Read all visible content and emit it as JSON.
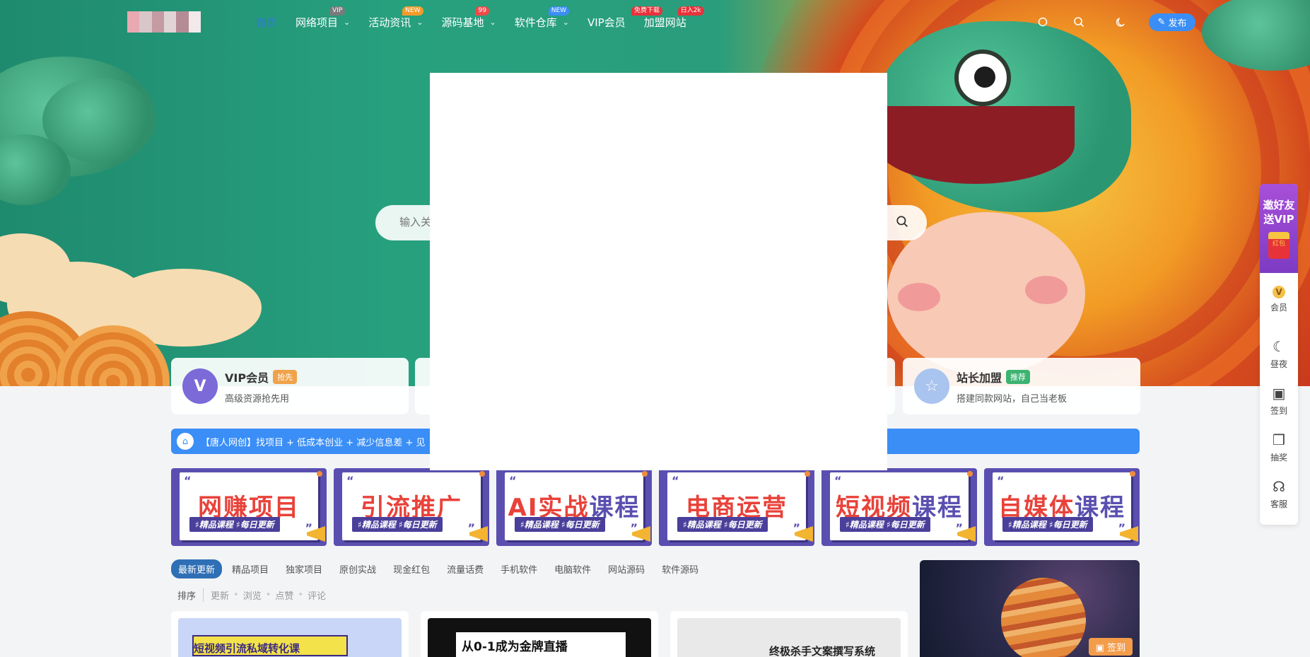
{
  "nav": {
    "items": [
      {
        "label": "首页",
        "badge": "",
        "badge_color": "",
        "chevron": false,
        "active": true
      },
      {
        "label": "网络项目",
        "badge": "VIP",
        "badge_color": "#7a7a7a",
        "chevron": true,
        "active": false
      },
      {
        "label": "活动资讯",
        "badge": "NEW",
        "badge_color": "#f59a2a",
        "chevron": true,
        "active": false
      },
      {
        "label": "源码基地",
        "badge": "99",
        "badge_color": "#ef4a4a",
        "chevron": true,
        "active": false
      },
      {
        "label": "软件仓库",
        "badge": "NEW",
        "badge_color": "#3a8ef6",
        "chevron": true,
        "active": false
      },
      {
        "label": "VIP会员",
        "badge": "免费下载",
        "badge_color": "#e8323a",
        "chevron": false,
        "active": false
      },
      {
        "label": "加盟网站",
        "badge": "日入2k",
        "badge_color": "#e8323a",
        "chevron": false,
        "active": false
      }
    ],
    "publish_label": "发布"
  },
  "search": {
    "placeholder": "输入关"
  },
  "features": [
    {
      "title": "VIP会员",
      "tag": "抢先",
      "tag_color": "#f0a24a",
      "subtitle": "高级资源抢先用",
      "icon": "vip-icon",
      "icon_text": "V",
      "icon_color": "#7b6ad8"
    },
    {
      "title": "站长加盟",
      "tag": "推荐",
      "tag_color": "#3cb371",
      "subtitle": "搭建同款网站，自己当老板",
      "icon": "gear-badge-icon",
      "icon_text": "☆",
      "icon_color": "#8fb2e8"
    }
  ],
  "notice": {
    "text": "【唐人网创】找项目 + 低成本创业 + 减少信息差 + 见"
  },
  "courses": [
    {
      "title": "网赚项目",
      "color": "#e8423a",
      "tags": "♯精品课程 ♯每日更新"
    },
    {
      "title": "引流推广",
      "color": "#e8423a",
      "tags": "♯精品课程 ♯每日更新"
    },
    {
      "title_a": "AI实战",
      "title_b": "课程",
      "color": "#e8423a",
      "color_b": "#5a4fb0",
      "tags": "♯精品课程 ♯每日更新"
    },
    {
      "title": "电商运营",
      "color": "#e8423a",
      "tags": "♯精品课程 ♯每日更新"
    },
    {
      "title_a": "短视频",
      "title_b": "课程",
      "color": "#e8423a",
      "color_b": "#5a4fb0",
      "tags": "♯精品课程 ♯每日更新"
    },
    {
      "title_a": "自媒体",
      "title_b": "课程",
      "color": "#e8423a",
      "color_b": "#5a4fb0",
      "tags": "♯精品课程 ♯每日更新"
    }
  ],
  "tabs": [
    "最新更新",
    "精品项目",
    "独家项目",
    "原创实战",
    "现金红包",
    "流量话费",
    "手机软件",
    "电脑软件",
    "网站源码",
    "软件源码"
  ],
  "sort": {
    "label": "排序",
    "options": [
      "更新",
      "浏览",
      "点赞",
      "评论"
    ]
  },
  "posts": [
    {
      "text": "短视频引流私域转化课",
      "bg": "#c9d6f7",
      "color": "#3b2a80"
    },
    {
      "text": "从0-1成为金牌直播",
      "bg": "#111111",
      "color": "#111111"
    },
    {
      "text": "终极杀手文案撰写系统",
      "bg": "#e9e9e9",
      "color": "#222222"
    }
  ],
  "widget": {
    "checkin_label": "签到"
  },
  "side": {
    "invite_line1": "邀好友",
    "invite_line2": "送VIP",
    "envelope_label": "红包",
    "items": [
      {
        "icon": "vip-member-icon",
        "label": "会员"
      },
      {
        "icon": "moon-icon",
        "label": "昼夜"
      },
      {
        "icon": "calendar-check-icon",
        "label": "签到"
      },
      {
        "icon": "gift-icon",
        "label": "抽奖"
      },
      {
        "icon": "headset-icon",
        "label": "客服"
      }
    ]
  }
}
